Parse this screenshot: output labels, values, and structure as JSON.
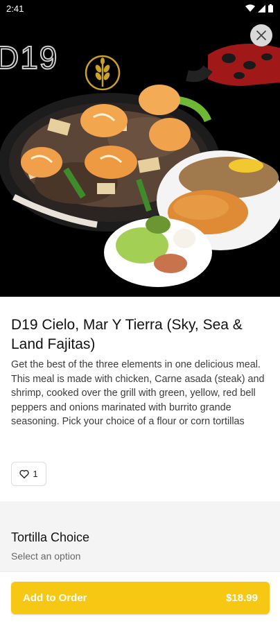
{
  "status_bar": {
    "time": "2:41"
  },
  "hero": {
    "brand_text": "D19"
  },
  "item": {
    "title": "D19 Cielo, Mar Y Tierra (Sky, Sea & Land Fajitas)",
    "description": "Get the best of the three elements in one delicious meal. This meal is made with chicken, Carne asada (steak) and shrimp, cooked over the grill with green, yellow, red bell peppers and onions marinated with burrito grande seasoning. Pick your choice of a flour or corn tortillas",
    "like_count": "1"
  },
  "options": {
    "title": "Tortilla Choice",
    "subtitle": "Select an option"
  },
  "order": {
    "button_label": "Add to Order",
    "price": "$18.99"
  },
  "colors": {
    "accent": "#f6c814",
    "hero_bg": "#000000"
  },
  "icons": {
    "close": "close-icon",
    "like": "heart-outline-icon",
    "wifi": "wifi-icon",
    "signal": "signal-icon",
    "battery": "battery-icon",
    "logo": "wheat-logo-icon"
  }
}
